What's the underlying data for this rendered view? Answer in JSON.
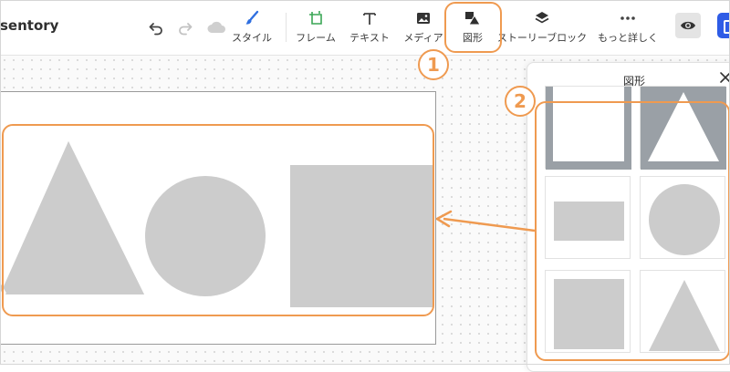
{
  "app": {
    "brand": "sentory"
  },
  "toolbar": {
    "tools": [
      {
        "id": "style",
        "label": "スタイル",
        "icon": "paintbrush-icon"
      },
      {
        "id": "frame",
        "label": "フレーム",
        "icon": "frame-icon"
      },
      {
        "id": "text",
        "label": "テキスト",
        "icon": "text-icon"
      },
      {
        "id": "media",
        "label": "メディア",
        "icon": "image-icon"
      },
      {
        "id": "shapes",
        "label": "図形",
        "icon": "shapes-icon"
      },
      {
        "id": "story_block",
        "label": "ストーリーブロック",
        "icon": "layers-icon"
      },
      {
        "id": "more",
        "label": "もっと詳しく",
        "icon": "more-dots-icon"
      }
    ],
    "icons": [
      "undo-icon",
      "redo-icon",
      "cloud-icon",
      "eye-icon"
    ]
  },
  "panel": {
    "title": "図形",
    "shapes": [
      "frame-square",
      "frame-triangle",
      "rectangle",
      "circle",
      "square",
      "triangle"
    ]
  },
  "annotations": {
    "step1": "1",
    "step2": "2"
  },
  "colors": {
    "accent": "#ef9a50",
    "shape_gray": "#cccccc",
    "frame_gray": "#9aa0a6",
    "publish_blue": "#2e5ce6",
    "style_blue": "#2f6fe0",
    "frame_green": "#3aa655"
  }
}
